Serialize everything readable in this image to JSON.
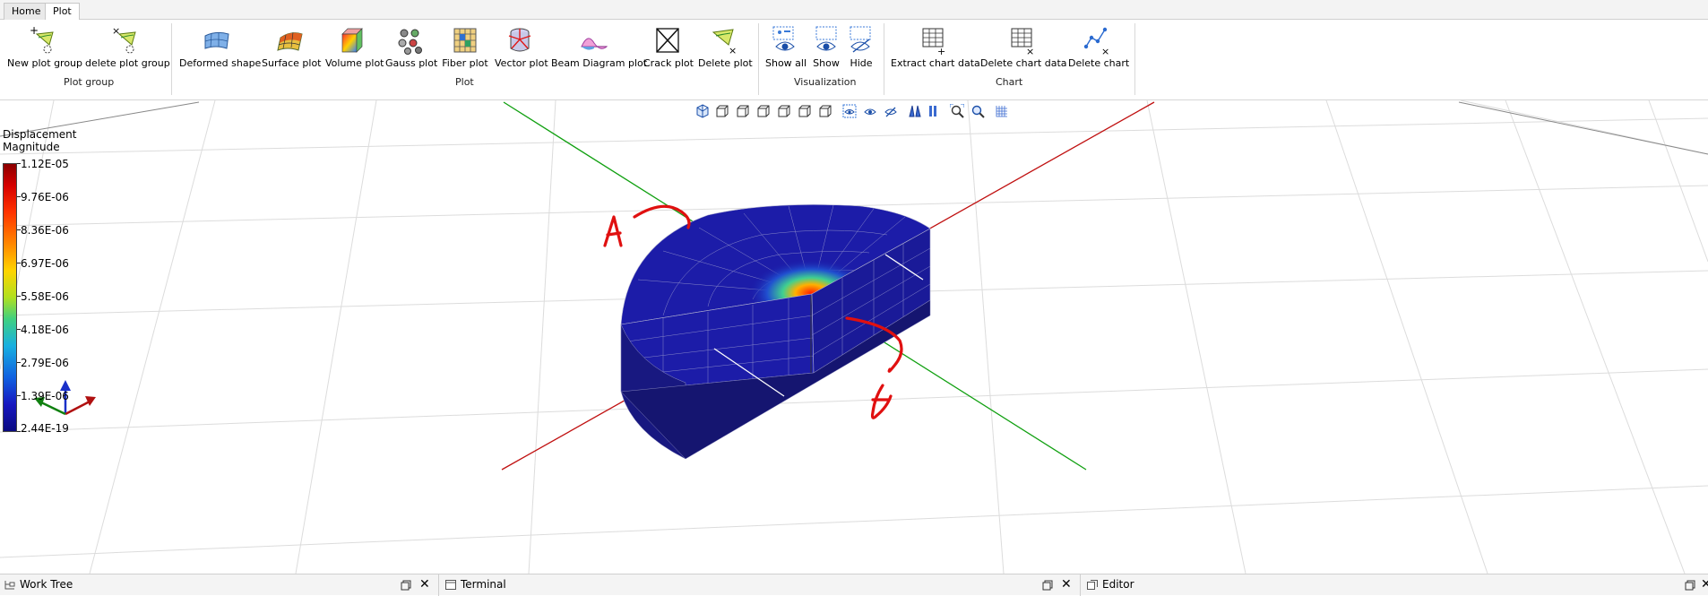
{
  "tabs": [
    {
      "label": "Home",
      "active": false
    },
    {
      "label": "Plot",
      "active": true
    }
  ],
  "ribbon": {
    "groups": {
      "plot_group": "Plot group",
      "plot": "Plot",
      "visualization": "Visualization",
      "chart": "Chart"
    },
    "buttons": {
      "new_plot_group": "New plot group",
      "delete_plot_group": "delete plot group",
      "deformed_shape": "Deformed shape",
      "surface_plot": "Surface plot",
      "volume_plot": "Volume plot",
      "gauss_plot": "Gauss plot",
      "fiber_plot": "Fiber plot",
      "vector_plot": "Vector plot",
      "beam_diagram_plot": "Beam Diagram plot",
      "crack_plot": "Crack plot",
      "delete_plot": "Delete plot",
      "show_all": "Show all",
      "show": "Show",
      "hide": "Hide",
      "extract_chart_data": "Extract chart data",
      "delete_chart_data": "Delete chart data",
      "delete_chart": "Delete chart"
    }
  },
  "viewport": {
    "legend": {
      "title_line1": "Displacement",
      "title_line2": "Magnitude",
      "values": [
        "1.12E-05",
        "9.76E-06",
        "8.36E-06",
        "6.97E-06",
        "5.58E-06",
        "4.18E-06",
        "2.79E-06",
        "1.39E-06",
        "2.44E-19"
      ]
    },
    "annotations": {
      "top_label": "A",
      "bottom_label": "A"
    },
    "colors": {
      "x_axis": "#c01010",
      "y_axis": "#10a010",
      "mesh_low": "#1c1ca8",
      "annotation": "#e01010"
    }
  },
  "dock": {
    "work_tree": "Work Tree",
    "terminal": "Terminal",
    "editor": "Editor"
  }
}
